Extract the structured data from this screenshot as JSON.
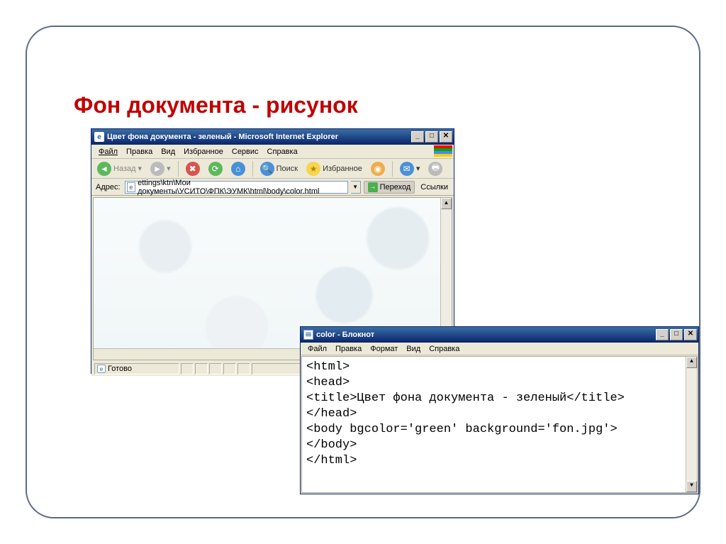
{
  "slide": {
    "title": "Фон документа - рисунок"
  },
  "ie": {
    "title": "Цвет фона документа - зеленый - Microsoft Internet Explorer",
    "menu": {
      "file": "Файл",
      "edit": "Правка",
      "view": "Вид",
      "fav": "Избранное",
      "tools": "Сервис",
      "help": "Справка"
    },
    "toolbar": {
      "back": "Назад",
      "search": "Поиск",
      "favorites": "Избранное"
    },
    "address": {
      "label": "Адрес:",
      "value": "ettings\\ktn\\Мои документы\\УСИТО\\ФПК\\ЭУМК\\html\\body\\color.html",
      "go": "Переход",
      "links": "Ссылки"
    },
    "status": "Готово"
  },
  "notepad": {
    "title": "color - Блокнот",
    "menu": {
      "file": "Файл",
      "edit": "Правка",
      "format": "Формат",
      "view": "Вид",
      "help": "Справка"
    },
    "code": "<html>\n<head>\n<title>Цвет фона документа - зеленый</title>\n</head>\n<body bgcolor='green' background='fon.jpg'>\n</body>\n</html>"
  }
}
